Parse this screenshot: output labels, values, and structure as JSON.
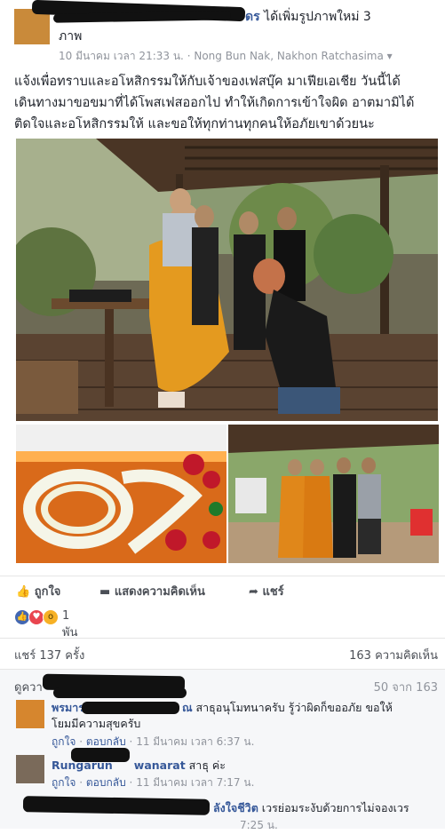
{
  "post": {
    "action_suffix": "ได้เพิ่มรูปภาพใหม่ 3",
    "action_suffix_visible_name_part": "ดร",
    "action_line2": "ภาพ",
    "date": "10 มีนาคม เวลา 21:33 น.",
    "separator": "·",
    "location": "Nong Bun Nak, Nakhon Ratchasima",
    "location_arrow": "▾",
    "caption_line1": "แจ้งเพื่อทราบและอโหสิกรรมให้กับเจ้าของเฟสบุ๊ค มาเฟียเอเชีย วันนี้ได้",
    "caption_line2": "เดินทางมาขอขมาที่ได้โพสเฟสออกไป ทำให้เกิดการเข้าใจผิด อาตมามิได้",
    "caption_line3": "ติดใจและอโหสิกรรมให้ และขอให้ทุกท่านทุกคนให้อภัยเขาด้วยนะ"
  },
  "actions": {
    "like": "ถูกใจ",
    "comment": "แสดงความคิดเห็น",
    "share": "แชร์"
  },
  "reactions": {
    "count": "1 พัน",
    "icons": [
      "like-icon",
      "love-icon",
      "wow-icon"
    ]
  },
  "stats": {
    "shares": "แชร์ 137 ครั้ง",
    "comments": "163 ความคิดเห็น"
  },
  "comments": {
    "view_more_prefix": "ดูควา",
    "pagination": "50 จาก 163",
    "items": [
      {
        "name_visible": "พรมาร",
        "name_tail": "ณ",
        "text_line1": "สาธุอนุโมทนาครับ รู้ว่าผิดก็ขออภัย ขอให้",
        "text_line2": "โยมมีความสุขครับ",
        "like": "ถูกใจ",
        "reply": "ตอบกลับ",
        "time": "11 มีนาคม เวลา 6:37 น."
      },
      {
        "name_visible": "Rungarun",
        "name_tail": "wanarat",
        "text": "สาธุ ค่ะ",
        "like": "ถูกใจ",
        "reply": "ตอบกลับ",
        "time": "11 มีนาคม เวลา 7:17 น."
      },
      {
        "name_tail": "ลังใจชีวิต",
        "text": "เวรย่อมระงับด้วยการไม่จองเวร",
        "time_partial": "7:25 น."
      }
    ]
  },
  "colors": {
    "link": "#365899",
    "meta": "#90949c",
    "text": "#1d2129",
    "like_blue": "#4267b2",
    "love_red": "#e9454f",
    "wow_yellow": "#f7b125"
  }
}
